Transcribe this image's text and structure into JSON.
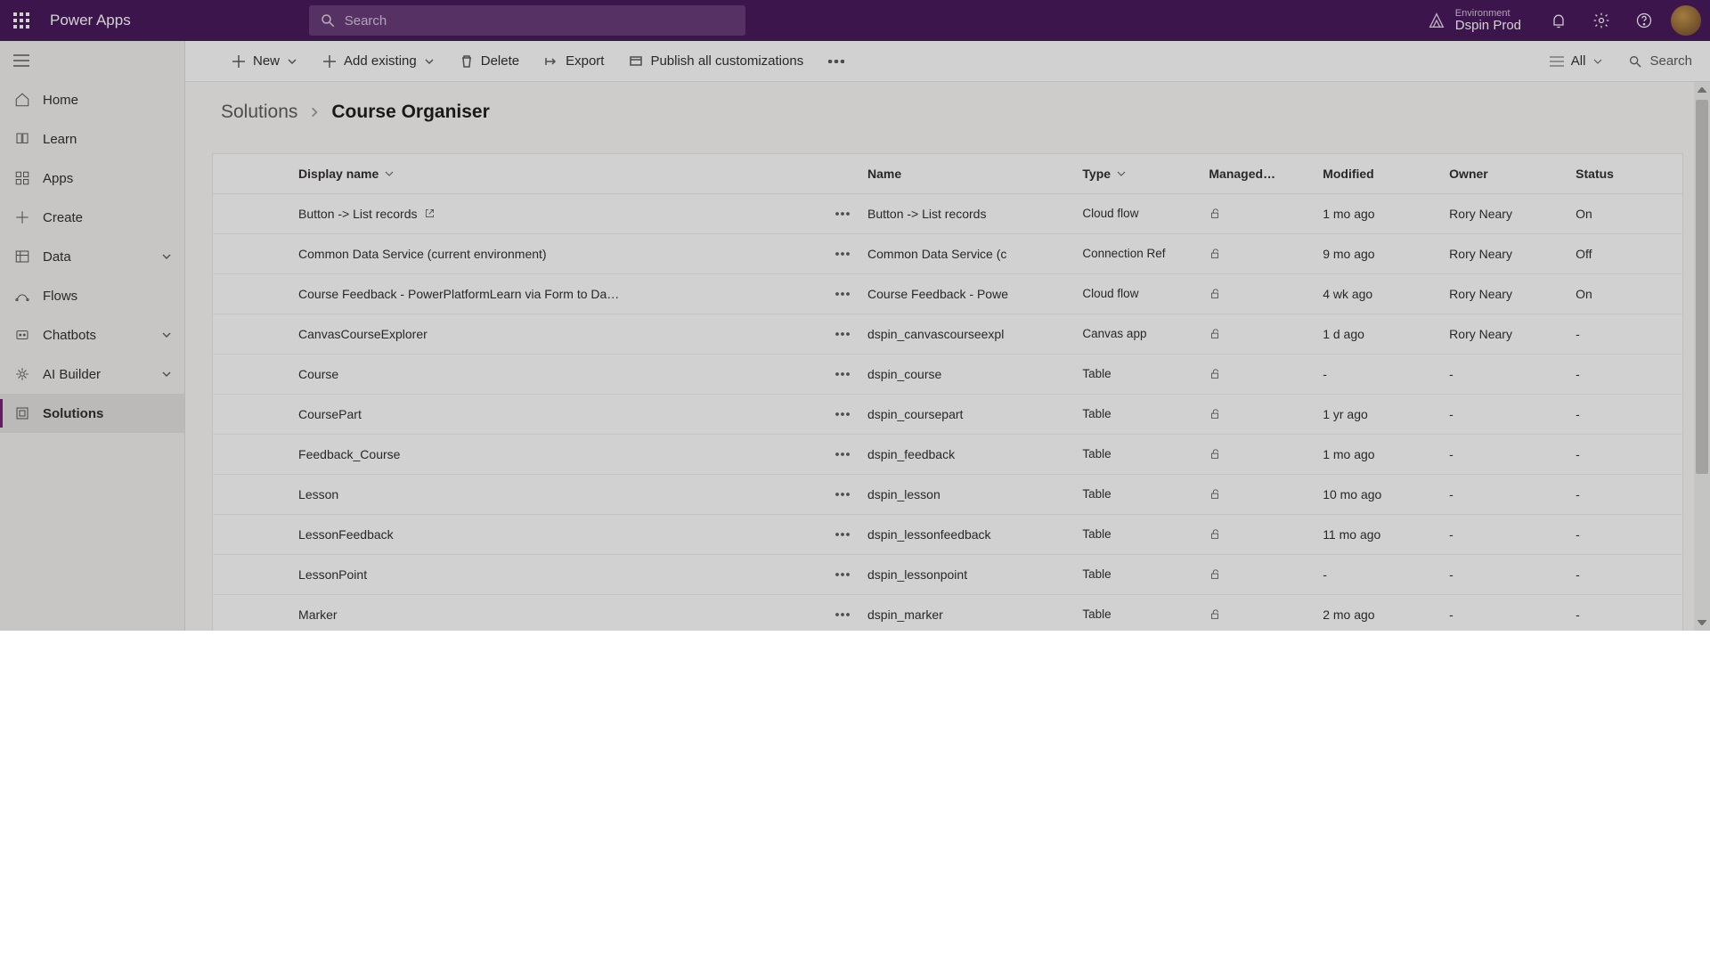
{
  "brand": "Power Apps",
  "globalSearchPlaceholder": "Search",
  "environment": {
    "label": "Environment",
    "name": "Dspin Prod"
  },
  "leftnav": {
    "items": [
      {
        "key": "home",
        "label": "Home"
      },
      {
        "key": "learn",
        "label": "Learn"
      },
      {
        "key": "apps",
        "label": "Apps"
      },
      {
        "key": "create",
        "label": "Create"
      },
      {
        "key": "data",
        "label": "Data",
        "expandable": true
      },
      {
        "key": "flows",
        "label": "Flows"
      },
      {
        "key": "chatbots",
        "label": "Chatbots",
        "expandable": true
      },
      {
        "key": "aibuilder",
        "label": "AI Builder",
        "expandable": true
      },
      {
        "key": "solutions",
        "label": "Solutions",
        "selected": true
      }
    ]
  },
  "commands": {
    "new": "New",
    "addExisting": "Add existing",
    "delete": "Delete",
    "export": "Export",
    "publish": "Publish all customizations",
    "viewLabel": "All",
    "searchLabel": "Search"
  },
  "breadcrumb": {
    "root": "Solutions",
    "current": "Course Organiser"
  },
  "columns": {
    "displayName": "Display name",
    "name": "Name",
    "type": "Type",
    "managed": "Managed…",
    "modified": "Modified",
    "owner": "Owner",
    "status": "Status"
  },
  "rows": [
    {
      "display": "Button -> List records",
      "ext": true,
      "name": "Button -> List records",
      "type": "Cloud flow",
      "modified": "1 mo ago",
      "owner": "Rory Neary",
      "status": "On"
    },
    {
      "display": "Common Data Service (current environment)",
      "name": "Common Data Service (c",
      "type": "Connection Ref",
      "modified": "9 mo ago",
      "owner": "Rory Neary",
      "status": "Off"
    },
    {
      "display": "Course Feedback - PowerPlatformLearn via Form to Da…",
      "name": "Course Feedback - Powe",
      "type": "Cloud flow",
      "modified": "4 wk ago",
      "owner": "Rory Neary",
      "status": "On"
    },
    {
      "display": "CanvasCourseExplorer",
      "name": "dspin_canvascourseexpl",
      "type": "Canvas app",
      "modified": "1 d ago",
      "owner": "Rory Neary",
      "status": "-"
    },
    {
      "display": "Course",
      "name": "dspin_course",
      "type": "Table",
      "modified": "-",
      "owner": "-",
      "status": "-"
    },
    {
      "display": "CoursePart",
      "name": "dspin_coursepart",
      "type": "Table",
      "modified": "1 yr ago",
      "owner": "-",
      "status": "-"
    },
    {
      "display": "Feedback_Course",
      "name": "dspin_feedback",
      "type": "Table",
      "modified": "1 mo ago",
      "owner": "-",
      "status": "-"
    },
    {
      "display": "Lesson",
      "name": "dspin_lesson",
      "type": "Table",
      "modified": "10 mo ago",
      "owner": "-",
      "status": "-"
    },
    {
      "display": "LessonFeedback",
      "name": "dspin_lessonfeedback",
      "type": "Table",
      "modified": "11 mo ago",
      "owner": "-",
      "status": "-"
    },
    {
      "display": "LessonPoint",
      "name": "dspin_lessonpoint",
      "type": "Table",
      "modified": "-",
      "owner": "-",
      "status": "-"
    },
    {
      "display": "Marker",
      "name": "dspin_marker",
      "type": "Table",
      "modified": "2 mo ago",
      "owner": "-",
      "status": "-"
    }
  ]
}
